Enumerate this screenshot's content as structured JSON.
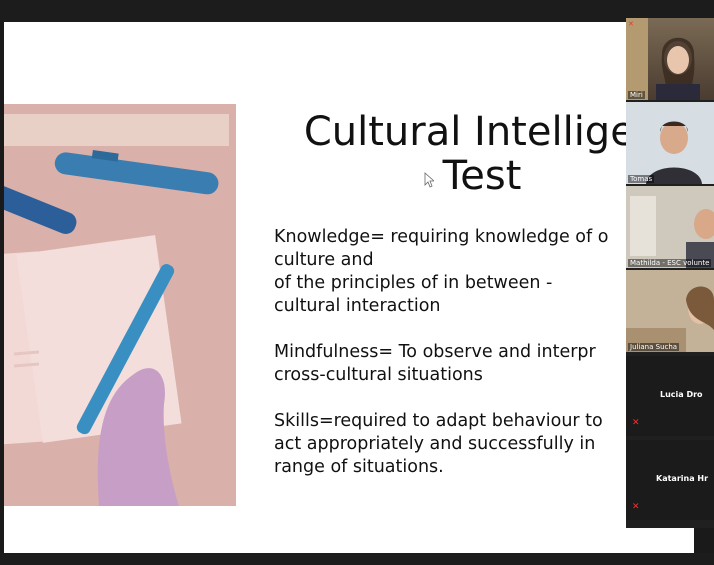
{
  "slide": {
    "title_line1": "Cultural Intelligen",
    "title_line2": "Test",
    "paragraphs": [
      "Knowledge=  requiring knowledge of o\nculture and\nof the principles of in between -\ncultural interaction",
      "Mindfulness= To observe and interpr\ncross-cultural situations",
      "Skills=required to adapt behaviour to\nact appropriately and successfully in\nrange of situations."
    ]
  },
  "participants": {
    "video_tiles": [
      {
        "name": "Miri"
      },
      {
        "name": "Tomas"
      },
      {
        "name": "Mathilda - ESC volunte"
      },
      {
        "name": "Juliana Sucha"
      }
    ],
    "name_tiles": [
      {
        "name": "Lucia Dro"
      },
      {
        "name": "Katarina  Hr"
      }
    ]
  },
  "colors": {
    "illustration_bg": "#d9b0aa",
    "pen_blue": "#3a7db0",
    "paper": "#f2d9d6",
    "mic_muted": "#e33333"
  },
  "icons": [
    "cursor-arrow-icon",
    "mic-muted-icon"
  ]
}
